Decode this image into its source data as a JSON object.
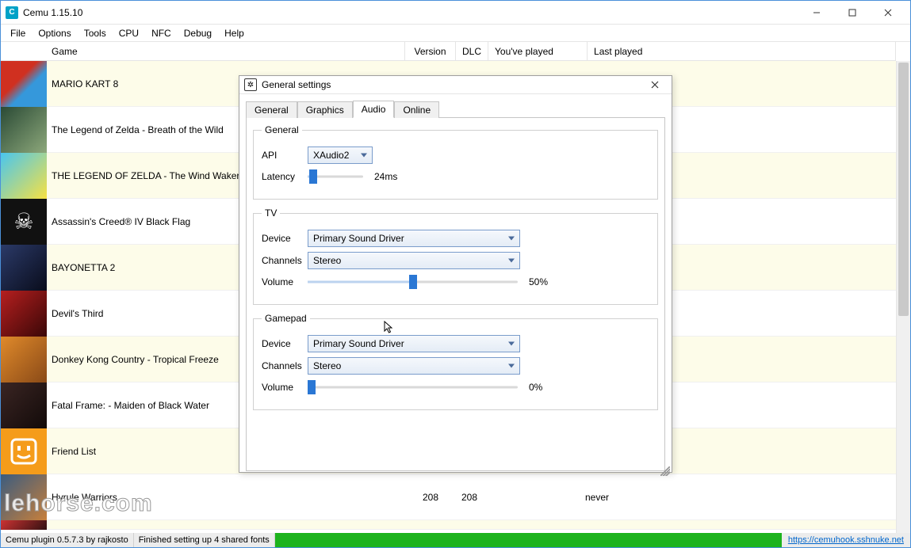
{
  "window": {
    "title": "Cemu 1.15.10",
    "app_letter": "C"
  },
  "window_controls": {
    "min": "minimize",
    "max": "maximize",
    "close": "close"
  },
  "menu": [
    "File",
    "Options",
    "Tools",
    "CPU",
    "NFC",
    "Debug",
    "Help"
  ],
  "columns": {
    "game": "Game",
    "version": "Version",
    "dlc": "DLC",
    "youve_played": "You've played",
    "last_played": "Last played"
  },
  "games": [
    {
      "name": "MARIO KART 8",
      "version": "",
      "dlc": "",
      "played": "",
      "last": "",
      "thumb": "t-mk8",
      "alt": true
    },
    {
      "name": "The Legend of Zelda - Breath of the Wild",
      "version": "",
      "dlc": "",
      "played": "",
      "last": "",
      "thumb": "t-botw",
      "alt": false
    },
    {
      "name": "THE LEGEND OF ZELDA - The Wind Waker HD",
      "version": "",
      "dlc": "",
      "played": "",
      "last": "",
      "thumb": "t-ww",
      "alt": true
    },
    {
      "name": "Assassin's Creed® IV Black Flag",
      "version": "",
      "dlc": "",
      "played": "",
      "last": "",
      "thumb": "t-ac4",
      "alt": false
    },
    {
      "name": "BAYONETTA 2",
      "version": "",
      "dlc": "",
      "played": "",
      "last": "",
      "thumb": "t-bay",
      "alt": true
    },
    {
      "name": "Devil's Third",
      "version": "",
      "dlc": "",
      "played": "",
      "last": "",
      "thumb": "t-dev",
      "alt": false
    },
    {
      "name": "Donkey Kong Country - Tropical Freeze",
      "version": "",
      "dlc": "",
      "played": "",
      "last": "",
      "thumb": "t-dk",
      "alt": true
    },
    {
      "name": "Fatal Frame:  - Maiden of Black Water",
      "version": "",
      "dlc": "",
      "played": "",
      "last": "",
      "thumb": "t-ff",
      "alt": false
    },
    {
      "name": "Friend List",
      "version": "",
      "dlc": "",
      "played": "",
      "last": "",
      "thumb": "t-fl",
      "alt": true
    },
    {
      "name": "Hyrule Warriors",
      "version": "208",
      "dlc": "208",
      "played": "",
      "last": "never",
      "thumb": "t-hy",
      "alt": false
    }
  ],
  "dialog": {
    "title": "General settings",
    "tabs": [
      "General",
      "Graphics",
      "Audio",
      "Online"
    ],
    "active_tab": "Audio",
    "audio": {
      "general": {
        "legend": "General",
        "api_label": "API",
        "api_value": "XAudio2",
        "latency_label": "Latency",
        "latency_value": "24ms",
        "latency_pct": 10
      },
      "tv": {
        "legend": "TV",
        "device_label": "Device",
        "device_value": "Primary Sound Driver",
        "channels_label": "Channels",
        "channels_value": "Stereo",
        "volume_label": "Volume",
        "volume_value": "50%",
        "volume_pct": 50
      },
      "gamepad": {
        "legend": "Gamepad",
        "device_label": "Device",
        "device_value": "Primary Sound Driver",
        "channels_label": "Channels",
        "channels_value": "Stereo",
        "volume_label": "Volume",
        "volume_value": "0%",
        "volume_pct": 2
      }
    }
  },
  "statusbar": {
    "plugin": "Cemu plugin 0.5.7.3 by rajkosto",
    "fonts": "Finished setting up 4 shared fonts",
    "link": "https://cemuhook.sshnuke.net"
  },
  "watermark": "lehorse.com"
}
